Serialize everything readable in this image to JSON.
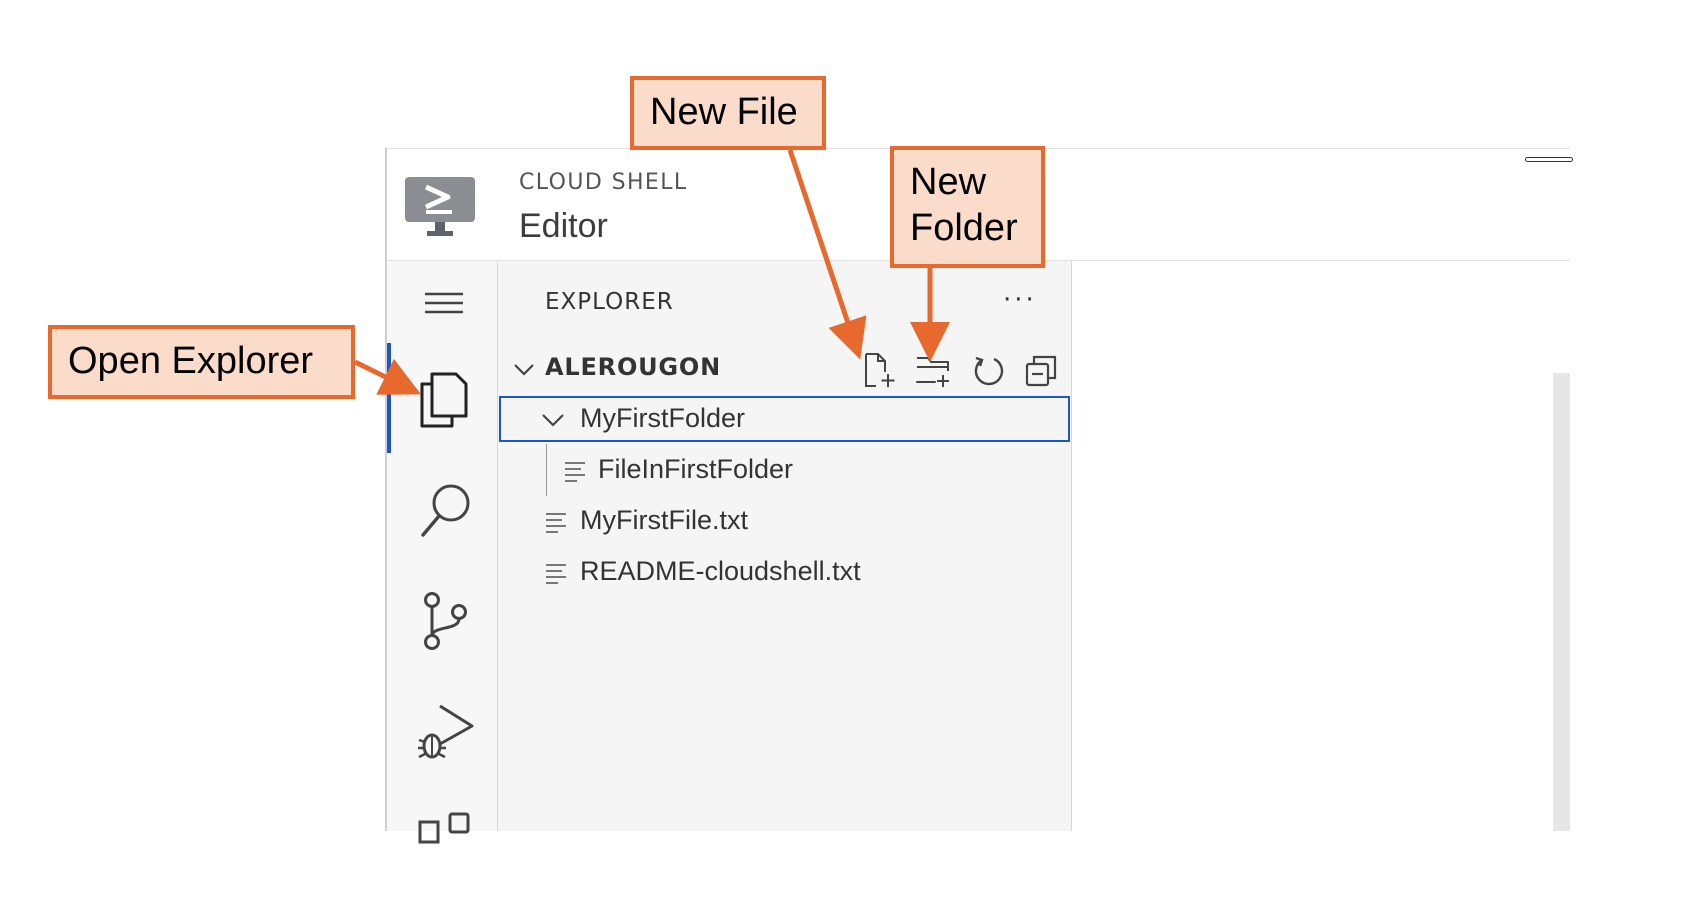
{
  "header": {
    "product": "CLOUD SHELL",
    "title": "Editor",
    "logo_icon": "cloud-shell-terminal-icon"
  },
  "activity_bar": {
    "items": [
      {
        "icon": "menu-icon"
      },
      {
        "icon": "files-icon",
        "active": true
      },
      {
        "icon": "search-icon"
      },
      {
        "icon": "source-control-icon"
      },
      {
        "icon": "run-debug-icon"
      },
      {
        "icon": "extensions-icon"
      }
    ]
  },
  "explorer": {
    "title": "EXPLORER",
    "more_label": "···",
    "root": {
      "name": "ALEROUGON",
      "actions": [
        "new-file-icon",
        "new-folder-icon",
        "refresh-icon",
        "collapse-all-icon"
      ]
    },
    "tree": [
      {
        "name": "MyFirstFolder",
        "type": "folder",
        "expanded": true,
        "selected": true
      },
      {
        "name": "FileInFirstFolder",
        "type": "file"
      },
      {
        "name": "MyFirstFile.txt",
        "type": "file"
      },
      {
        "name": "README-cloudshell.txt",
        "type": "file"
      }
    ]
  },
  "annotations": {
    "new_file": "New File",
    "new_folder_line1": "New",
    "new_folder_line2": "Folder",
    "open_explorer": "Open Explorer",
    "accent_color": "#e8692d",
    "fill_color": "#fbdccb"
  },
  "theme": {
    "active_accent": "#1a57c9"
  }
}
